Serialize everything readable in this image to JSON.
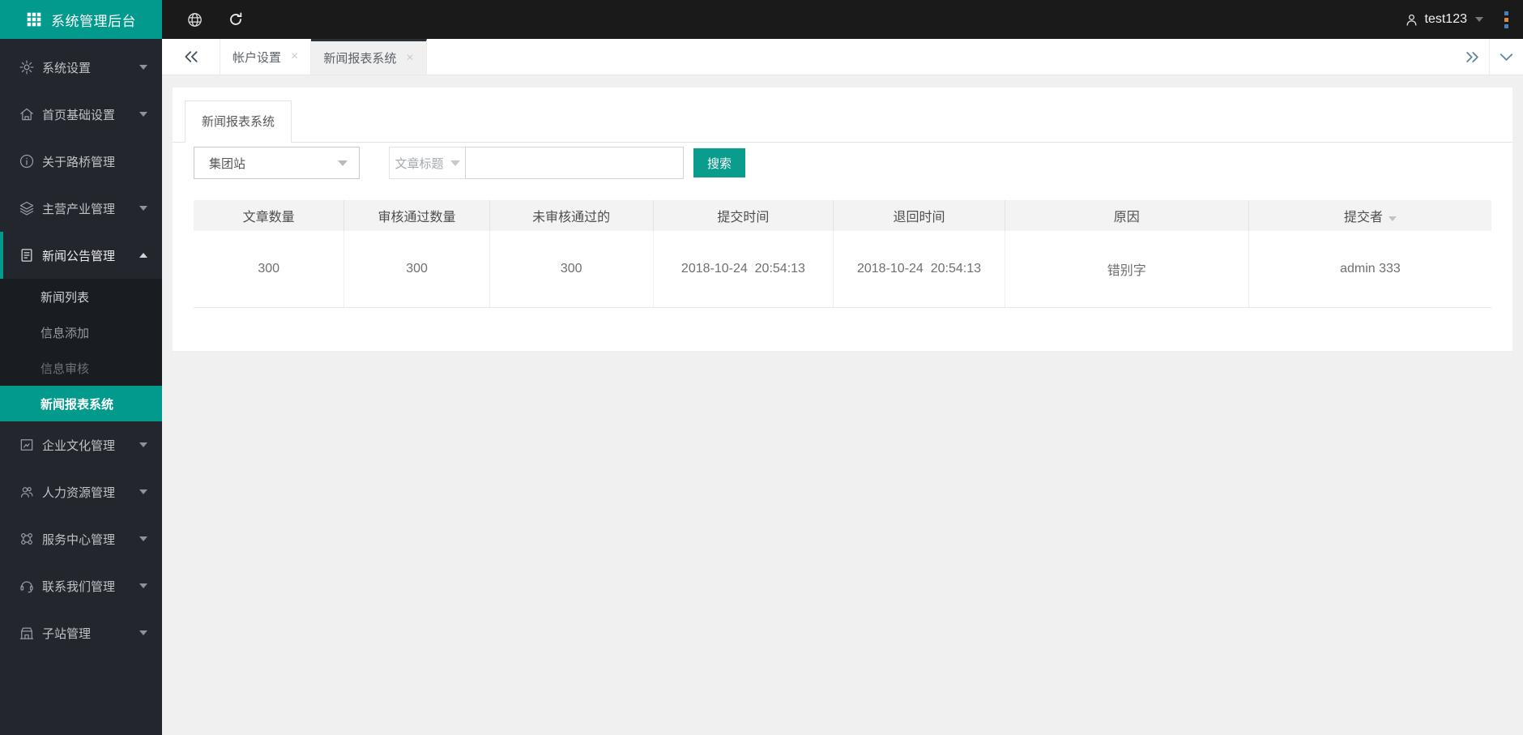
{
  "app": {
    "title": "系统管理后台"
  },
  "topbar": {
    "username": "test123",
    "icons": [
      "globe-icon",
      "refresh-icon",
      "user-icon",
      "kebab-menu-icon"
    ]
  },
  "tabbar": {
    "tabs": [
      {
        "label": "帐户设置",
        "active": false
      },
      {
        "label": "新闻报表系统",
        "active": true
      }
    ],
    "controls": [
      "scroll-left",
      "scroll-right",
      "collapse"
    ]
  },
  "sidebar": {
    "items": [
      {
        "label": "系统设置",
        "icon": "gear-icon",
        "expandable": true
      },
      {
        "label": "首页基础设置",
        "icon": "home-icon",
        "expandable": true
      },
      {
        "label": "关于路桥管理",
        "icon": "info-icon",
        "expandable": false
      },
      {
        "label": "主营产业管理",
        "icon": "layers-icon",
        "expandable": true
      },
      {
        "label": "新闻公告管理",
        "icon": "news-document-icon",
        "expandable": true,
        "expanded": true,
        "children": [
          {
            "label": "新闻列表",
            "active": false
          },
          {
            "label": "信息添加",
            "active": false
          },
          {
            "label": "信息审核",
            "active": false
          },
          {
            "label": "新闻报表系统",
            "active": true
          }
        ]
      },
      {
        "label": "企业文化管理",
        "icon": "culture-frame-icon",
        "expandable": true
      },
      {
        "label": "人力资源管理",
        "icon": "people-icon",
        "expandable": true
      },
      {
        "label": "服务中心管理",
        "icon": "service-center-icon",
        "expandable": true
      },
      {
        "label": "联系我们管理",
        "icon": "headset-icon",
        "expandable": true
      },
      {
        "label": "子站管理",
        "icon": "substation-icon",
        "expandable": true
      }
    ]
  },
  "panel": {
    "card_tab": "新闻报表系统",
    "filters": {
      "site_select_value": "集团站",
      "field_select_value": "文章标题",
      "search_value": "",
      "search_button": "搜索"
    }
  },
  "table": {
    "headers": [
      "文章数量",
      "审核通过数量",
      "未审核通过的",
      "提交时间",
      "退回时间",
      "原因",
      "提交者"
    ],
    "sortable_header_index": 6,
    "rows": [
      {
        "cells": [
          "300",
          "300",
          "300",
          "2018-10-24  20:54:13",
          "2018-10-24  20:54:13",
          "错别字",
          "admin 333"
        ]
      }
    ]
  },
  "colors": {
    "accent_teal": "#019a8c",
    "button_teal": "#0a9d8d",
    "topbar_bg": "#1a1a1a",
    "sidebar_bg": "#23262c",
    "submenu_bg": "#191c20",
    "content_bg": "#f0f0f1",
    "active_tab_top_border": "#2c3136",
    "kebab_dot_blue": "#4a7fbe",
    "kebab_dot_orange": "#d98b3a"
  }
}
